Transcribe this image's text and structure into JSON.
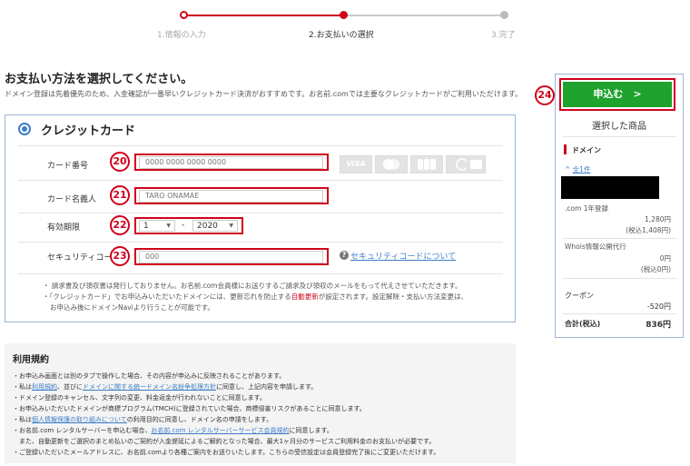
{
  "steps": [
    {
      "label": "1.情報の入力",
      "state": "done"
    },
    {
      "label": "2.お支払いの選択",
      "state": "current"
    },
    {
      "label": "3.完了",
      "state": "todo"
    }
  ],
  "heading": "お支払い方法を選択してください。",
  "description": "ドメイン登録は先着優先のため、入金確認が一番早いクレジットカード決済がおすすめです。お名前.comでは主要なクレジットカードがご利用いただけます。",
  "credit": {
    "title": "クレジットカード",
    "card_number": {
      "label": "カード番号",
      "placeholder": "0000 0000 0000 0000",
      "badge": "20"
    },
    "holder": {
      "label": "カード名義人",
      "placeholder": "TARO ONAMAE",
      "badge": "21"
    },
    "expiry": {
      "label": "有効期限",
      "month": "1",
      "separator": "-",
      "year": "2020",
      "badge": "22"
    },
    "security": {
      "label": "セキュリティコード",
      "placeholder": "000",
      "badge": "23",
      "help_link": "セキュリティコードについて"
    },
    "logos": [
      "VISA",
      "MC",
      "JCB",
      "DINERS",
      "AMEX"
    ],
    "notes": {
      "n1": "・ 請求書及び領収書は発行しておりません。お名前.com会員様にお送りするご請求及び領収のメールをもって代えさせていただきます。",
      "n2a": "・「クレジットカード」でお申込みいただいたドメインには、更新忘れを防止する",
      "n2red": "自動更新",
      "n2b": "が設定されます。設定解除・支払い方法変更は、",
      "n3": "お申込み後にドメインNaviより行うことが可能です。"
    }
  },
  "terms": {
    "title": "利用規約",
    "l1": "・お申込み画面とは別のタブで操作した場合、その内容が申込みに反映されることがあります。",
    "l2a": "・私は",
    "l2link1": "利用規約",
    "l2b": "、並びに",
    "l2link2": "ドメインに関する統一ドメイン名紛争処理方針",
    "l2c": "に同意し、上記内容を申請します。",
    "l3": "・ドメイン登録のキャンセル、文字列の変更、料金返金が行われないことに同意します。",
    "l4": "・お申込みいただいたドメインが商標プログラム(TMCH)に登録されていた場合、商標侵害リスクがあることに同意します。",
    "l5a": "・私は",
    "l5link": "個人情報保護の取り組みについて",
    "l5b": "の利用目的に同意し、ドメイン名の申請をします。",
    "l6a": "・お名前.com レンタルサーバーを申込む場合、",
    "l6link": "お名前.com レンタルサーバーサービス会員規約",
    "l6b": "に同意します。",
    "l7": "　また、自動更新をご選択のまとめ払いのご契約が入金遅延によるご解約となった場合、最大1ヶ月分のサービスご利用料金のお支払いが必要です。",
    "l8": "・ご登録いただいたメールアドレスに、お名前.comより各種ご案内をお送りいたします。こちらの受信設定は会員登録完了後にご変更いただけます。"
  },
  "sidebar": {
    "apply_label": "申込む　>",
    "apply_badge": "24",
    "selected_title": "選択した商品",
    "domain_heading": "ドメイン",
    "all_count": "全1件",
    "item_line": ".com 1年登録",
    "item_price": "1,280円",
    "item_tax": "(税込1,408円)",
    "whois_label": "Whois情報公開代行",
    "whois_price": "0円",
    "whois_tax": "(税込0円)",
    "coupon_label": "クーポン",
    "coupon_value": "-520円",
    "total_label": "合計(税込)",
    "total_value": "836円"
  },
  "colors": {
    "accent": "#d0021b",
    "button": "#1fa22e",
    "link": "#3d7ec9"
  }
}
